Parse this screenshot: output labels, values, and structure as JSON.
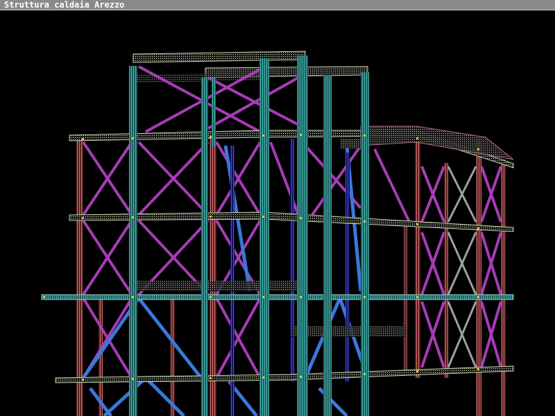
{
  "window": {
    "title": "Struttura caldaia Arezzo"
  },
  "palette": {
    "background": "#000000",
    "titlebar": "#8a8a8a",
    "column_teal": "#2e8b8b",
    "column_red": "#b05050",
    "brace_magenta": "#b040c0",
    "brace_blue": "#3a78d8",
    "beam_deck": "#c8d8b0",
    "column_blue": "#3030c0",
    "node_marker": "#d8d030"
  }
}
